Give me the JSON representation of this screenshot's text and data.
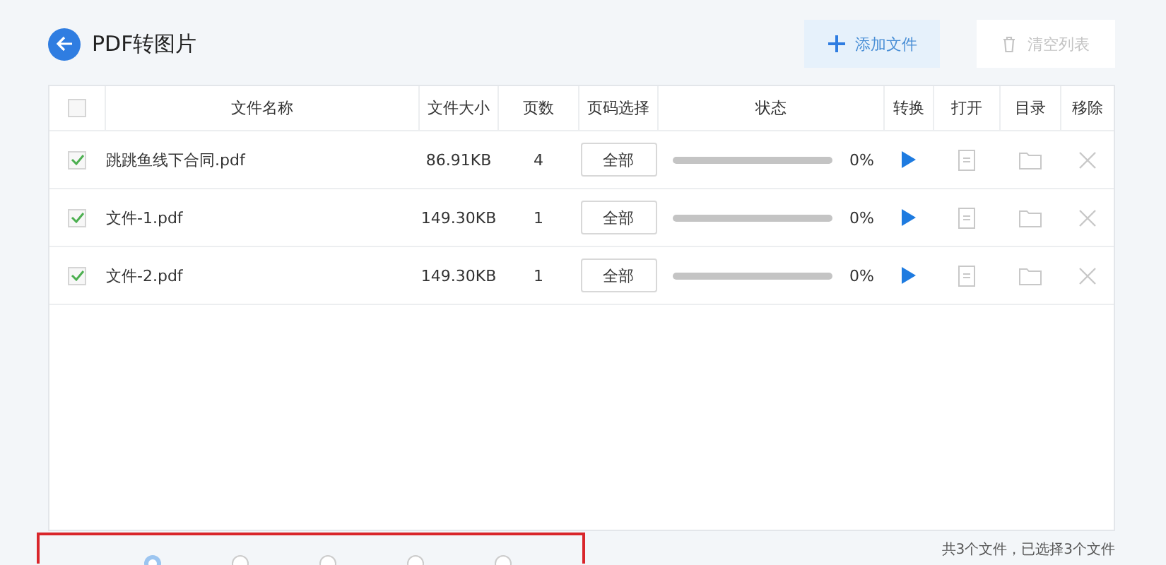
{
  "header": {
    "title": "PDF转图片",
    "buttons": [
      {
        "label": "添加文件",
        "kind": "add",
        "disabled": false
      },
      {
        "label": "清空列表",
        "kind": "clear",
        "disabled": true
      }
    ]
  },
  "table": {
    "all_checked": false,
    "columns": [
      "文件名称",
      "文件大小",
      "页数",
      "页码选择",
      "状态",
      "转换",
      "打开",
      "目录",
      "移除"
    ],
    "rows": [
      {
        "checked": true,
        "name": "跳跳鱼线下合同.pdf",
        "size": "86.91KB",
        "pages": "4",
        "page_select": "全部",
        "level": 0,
        "reading": "0%"
      },
      {
        "checked": true,
        "name": "文件-1.pdf",
        "size": "149.30KB",
        "pages": "1",
        "page_select": "全部",
        "level": 0,
        "reading": "0%"
      },
      {
        "checked": true,
        "name": "文件-2.pdf",
        "size": "149.30KB",
        "pages": "1",
        "page_select": "全部",
        "level": 0,
        "reading": "0%"
      }
    ]
  },
  "summary": "共3个文件，已选择3个文件",
  "output_format": {
    "options": [
      {
        "selected": true
      },
      {
        "selected": false
      },
      {
        "selected": false
      },
      {
        "selected": false
      },
      {
        "selected": false
      }
    ]
  }
}
